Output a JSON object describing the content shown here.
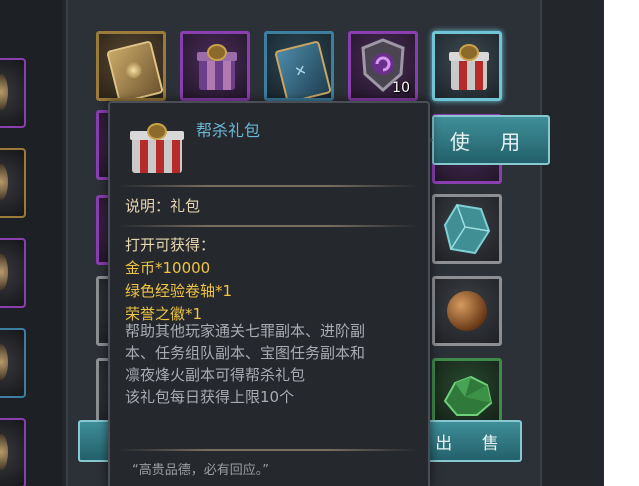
{
  "top_row": [
    {
      "name": "gold-card",
      "quality": "gold"
    },
    {
      "name": "purple-gift",
      "quality": "purple"
    },
    {
      "name": "blue-card",
      "quality": "blue"
    },
    {
      "name": "shield-emblem",
      "quality": "purple",
      "count": "10"
    },
    {
      "name": "gift-pack",
      "quality": "cyan",
      "selected": true
    }
  ],
  "actions": {
    "use_label": "使 用",
    "sell_label": "出 售"
  },
  "tooltip": {
    "title": "帮杀礼包",
    "icon": "gift-box-icon",
    "type_line": "说明：礼包",
    "obtain_header": "打开可获得：",
    "rewards": [
      "金币*10000",
      "绿色经验卷轴*1",
      "荣誉之徽*1"
    ],
    "description": [
      "帮助其他玩家通关七罪副本、进阶副",
      "本、任务组队副本、宝图任务副本和",
      "凛夜烽火副本可得帮杀礼包",
      "该礼包每日获得上限10个"
    ],
    "quote": "“高贵品德，必有回应。”"
  },
  "colors": {
    "title": "#69b8d6",
    "obtain_header": "#e8d7b0",
    "reward": "#f0c443",
    "description": "#a8acb2",
    "button": "#2f7b86",
    "selected_border": "#6fc4d6"
  }
}
